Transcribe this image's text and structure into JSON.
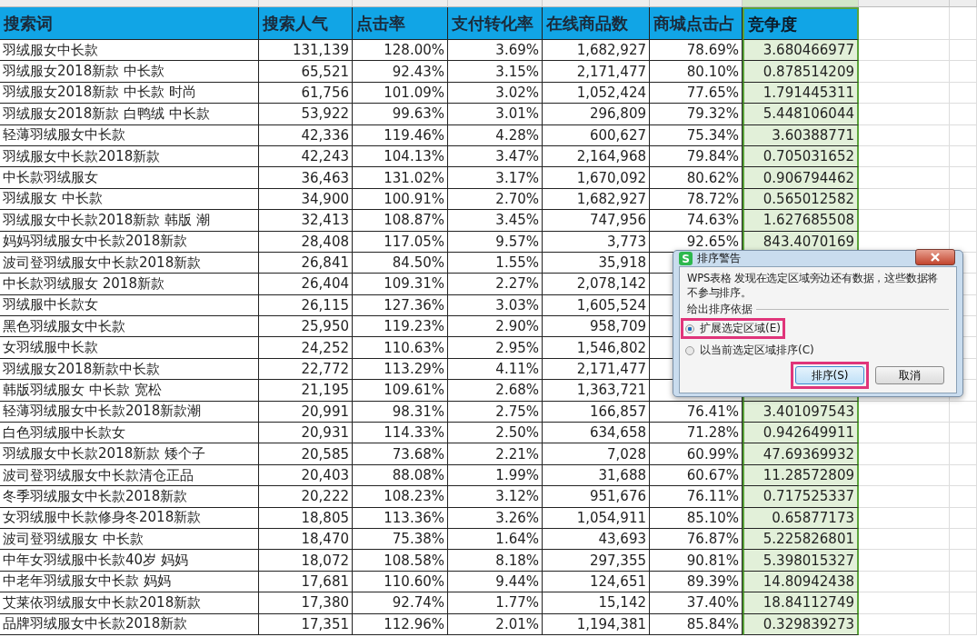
{
  "columns": [
    {
      "label": "搜索词",
      "selected": false
    },
    {
      "label": "搜索人气",
      "selected": false
    },
    {
      "label": "点击率",
      "selected": false
    },
    {
      "label": "支付转化率",
      "selected": false
    },
    {
      "label": "在线商品数",
      "selected": false
    },
    {
      "label": "商城点击占",
      "selected": false
    },
    {
      "label": "竞争度",
      "selected": true
    }
  ],
  "rows": [
    {
      "cells": [
        "羽绒服女中长款",
        "131,139",
        "128.00%",
        "3.69%",
        "1,682,927",
        "78.69%",
        "3.680466977"
      ]
    },
    {
      "cells": [
        "羽绒服女2018新款 中长款",
        "65,521",
        "92.43%",
        "3.15%",
        "2,171,477",
        "80.10%",
        "0.878514209"
      ]
    },
    {
      "cells": [
        "羽绒服女2018新款 中长款 时尚",
        "61,756",
        "101.09%",
        "3.02%",
        "1,052,424",
        "77.65%",
        "1.791445311"
      ]
    },
    {
      "cells": [
        "羽绒服女2018新款 白鸭绒 中长款",
        "53,922",
        "99.63%",
        "3.01%",
        "296,809",
        "79.32%",
        "5.448106044"
      ]
    },
    {
      "cells": [
        "轻薄羽绒服女中长款",
        "42,336",
        "119.46%",
        "4.28%",
        "600,627",
        "75.34%",
        "3.60388771"
      ]
    },
    {
      "cells": [
        "羽绒服女中长款2018新款",
        "42,243",
        "104.13%",
        "3.47%",
        "2,164,968",
        "79.84%",
        "0.705031652"
      ]
    },
    {
      "cells": [
        "中长款羽绒服女",
        "36,463",
        "131.02%",
        "3.17%",
        "1,670,092",
        "80.62%",
        "0.906794462"
      ]
    },
    {
      "cells": [
        "羽绒服女 中长款",
        "34,900",
        "100.91%",
        "2.70%",
        "1,682,927",
        "78.72%",
        "0.565012582"
      ]
    },
    {
      "cells": [
        "羽绒服女中长款2018新款 韩版 潮",
        "32,413",
        "108.87%",
        "3.45%",
        "747,956",
        "74.63%",
        "1.627685508"
      ]
    },
    {
      "cells": [
        "妈妈羽绒服女中长款2018新款",
        "28,408",
        "117.05%",
        "9.57%",
        "3,773",
        "92.65%",
        "843.4070169"
      ]
    },
    {
      "cells": [
        "波司登羽绒服女中长款2018新款",
        "26,841",
        "84.50%",
        "1.55%",
        "35,918"
      ]
    },
    {
      "cells": [
        "中长款羽绒服女 2018新款",
        "26,404",
        "109.31%",
        "2.27%",
        "2,078,142"
      ]
    },
    {
      "cells": [
        "羽绒服中长款女",
        "26,115",
        "127.36%",
        "3.03%",
        "1,605,524"
      ]
    },
    {
      "cells": [
        "黑色羽绒服女中长款",
        "25,950",
        "119.23%",
        "2.90%",
        "958,709"
      ]
    },
    {
      "cells": [
        "女羽绒服中长款",
        "24,252",
        "110.63%",
        "2.95%",
        "1,546,802"
      ]
    },
    {
      "cells": [
        "羽绒服女2018新款中长款",
        "22,772",
        "113.29%",
        "4.11%",
        "2,171,477"
      ]
    },
    {
      "cells": [
        "韩版羽绒服女 中长款 宽松",
        "21,195",
        "109.61%",
        "2.68%",
        "1,363,721"
      ]
    },
    {
      "cells": [
        "轻薄羽绒服女中长款2018新款潮",
        "20,991",
        "98.31%",
        "2.75%",
        "166,857",
        "76.41%",
        "3.401097543"
      ]
    },
    {
      "cells": [
        "白色羽绒服中长款女",
        "20,931",
        "114.33%",
        "2.50%",
        "634,658",
        "71.28%",
        "0.942649911"
      ]
    },
    {
      "cells": [
        "羽绒服女中长款2018新款 矮个子",
        "20,585",
        "73.68%",
        "2.21%",
        "7,028",
        "60.99%",
        "47.69369932"
      ]
    },
    {
      "cells": [
        "波司登羽绒服女中长款清仓正品",
        "20,403",
        "88.08%",
        "1.99%",
        "31,688",
        "60.67%",
        "11.28572809"
      ]
    },
    {
      "cells": [
        "冬季羽绒服女中长款2018新款",
        "20,222",
        "108.23%",
        "3.12%",
        "951,676",
        "76.11%",
        "0.717525337"
      ]
    },
    {
      "cells": [
        "女羽绒服中长款修身冬2018新款",
        "18,805",
        "113.36%",
        "3.26%",
        "1,054,911",
        "85.10%",
        "0.65877173"
      ]
    },
    {
      "cells": [
        "波司登羽绒服女 中长款",
        "18,470",
        "75.38%",
        "1.64%",
        "43,693",
        "76.87%",
        "5.225826801"
      ]
    },
    {
      "cells": [
        "中年女羽绒服中长款40岁 妈妈",
        "18,072",
        "108.58%",
        "8.18%",
        "297,355",
        "90.81%",
        "5.398015327"
      ]
    },
    {
      "cells": [
        "中老年羽绒服女中长款 妈妈",
        "17,681",
        "110.60%",
        "9.44%",
        "124,651",
        "89.39%",
        "14.80942438"
      ]
    },
    {
      "cells": [
        "艾莱依羽绒服女中长款2018新款",
        "17,380",
        "92.74%",
        "1.77%",
        "15,142",
        "37.40%",
        "18.84112749"
      ]
    },
    {
      "cells": [
        "品牌羽绒服女中长款2018新款",
        "17,351",
        "112.96%",
        "2.01%",
        "1,194,381",
        "85.84%",
        "0.329839273"
      ]
    }
  ],
  "dialog": {
    "app_icon": "S",
    "title": "排序警告",
    "message": "WPS表格 发现在选定区域旁边还有数据，这些数据将不参与排序。",
    "group_label": "给出排序依据",
    "options": [
      {
        "label": "扩展选定区域(E)",
        "selected": true,
        "highlighted": true
      },
      {
        "label": "以当前选定区域排序(C)",
        "selected": false,
        "highlighted": false
      }
    ],
    "buttons": [
      {
        "label": "排序(S)",
        "kind": "primary",
        "highlighted": true
      },
      {
        "label": "取消",
        "kind": "secondary",
        "highlighted": false
      }
    ]
  }
}
